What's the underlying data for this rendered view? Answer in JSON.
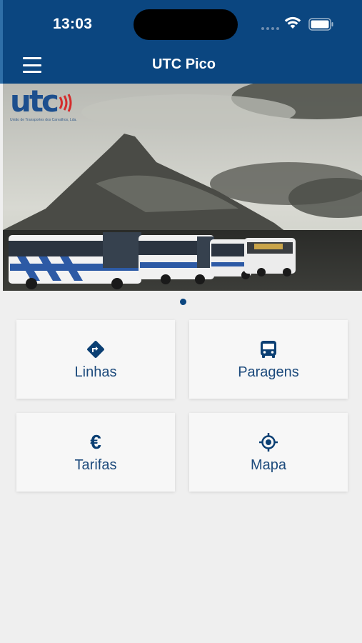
{
  "status_bar": {
    "time": "13:03"
  },
  "nav": {
    "title": "UTC Pico"
  },
  "banner": {
    "logo_text": "utc",
    "logo_subtitle": "União de Transportes dos Carvalhos, Lda."
  },
  "tiles": [
    {
      "label": "Linhas",
      "icon": "route-direction-icon"
    },
    {
      "label": "Paragens",
      "icon": "bus-icon"
    },
    {
      "label": "Tarifas",
      "icon": "euro-icon",
      "symbol": "€"
    },
    {
      "label": "Mapa",
      "icon": "location-target-icon"
    }
  ],
  "colors": {
    "primary": "#0b4680",
    "tile_text": "#1c4a7c",
    "background": "#efefef"
  }
}
